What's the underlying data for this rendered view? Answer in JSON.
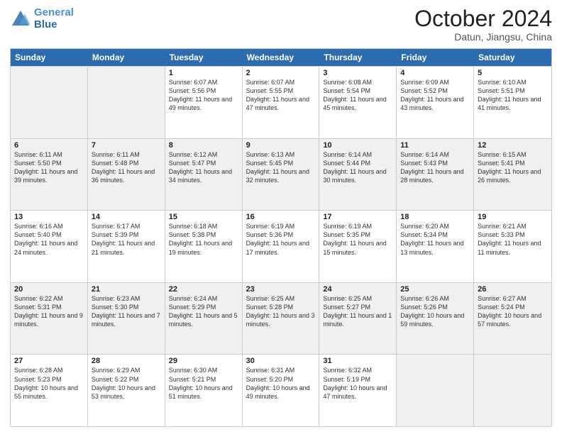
{
  "header": {
    "logo_line1": "General",
    "logo_line2": "Blue",
    "month": "October 2024",
    "location": "Datun, Jiangsu, China"
  },
  "days": [
    "Sunday",
    "Monday",
    "Tuesday",
    "Wednesday",
    "Thursday",
    "Friday",
    "Saturday"
  ],
  "weeks": [
    [
      {
        "day": "",
        "info": ""
      },
      {
        "day": "",
        "info": ""
      },
      {
        "day": "1",
        "info": "Sunrise: 6:07 AM\nSunset: 5:56 PM\nDaylight: 11 hours and 49 minutes."
      },
      {
        "day": "2",
        "info": "Sunrise: 6:07 AM\nSunset: 5:55 PM\nDaylight: 11 hours and 47 minutes."
      },
      {
        "day": "3",
        "info": "Sunrise: 6:08 AM\nSunset: 5:54 PM\nDaylight: 11 hours and 45 minutes."
      },
      {
        "day": "4",
        "info": "Sunrise: 6:09 AM\nSunset: 5:52 PM\nDaylight: 11 hours and 43 minutes."
      },
      {
        "day": "5",
        "info": "Sunrise: 6:10 AM\nSunset: 5:51 PM\nDaylight: 11 hours and 41 minutes."
      }
    ],
    [
      {
        "day": "6",
        "info": "Sunrise: 6:11 AM\nSunset: 5:50 PM\nDaylight: 11 hours and 39 minutes."
      },
      {
        "day": "7",
        "info": "Sunrise: 6:11 AM\nSunset: 5:48 PM\nDaylight: 11 hours and 36 minutes."
      },
      {
        "day": "8",
        "info": "Sunrise: 6:12 AM\nSunset: 5:47 PM\nDaylight: 11 hours and 34 minutes."
      },
      {
        "day": "9",
        "info": "Sunrise: 6:13 AM\nSunset: 5:45 PM\nDaylight: 11 hours and 32 minutes."
      },
      {
        "day": "10",
        "info": "Sunrise: 6:14 AM\nSunset: 5:44 PM\nDaylight: 11 hours and 30 minutes."
      },
      {
        "day": "11",
        "info": "Sunrise: 6:14 AM\nSunset: 5:43 PM\nDaylight: 11 hours and 28 minutes."
      },
      {
        "day": "12",
        "info": "Sunrise: 6:15 AM\nSunset: 5:41 PM\nDaylight: 11 hours and 26 minutes."
      }
    ],
    [
      {
        "day": "13",
        "info": "Sunrise: 6:16 AM\nSunset: 5:40 PM\nDaylight: 11 hours and 24 minutes."
      },
      {
        "day": "14",
        "info": "Sunrise: 6:17 AM\nSunset: 5:39 PM\nDaylight: 11 hours and 21 minutes."
      },
      {
        "day": "15",
        "info": "Sunrise: 6:18 AM\nSunset: 5:38 PM\nDaylight: 11 hours and 19 minutes."
      },
      {
        "day": "16",
        "info": "Sunrise: 6:19 AM\nSunset: 5:36 PM\nDaylight: 11 hours and 17 minutes."
      },
      {
        "day": "17",
        "info": "Sunrise: 6:19 AM\nSunset: 5:35 PM\nDaylight: 11 hours and 15 minutes."
      },
      {
        "day": "18",
        "info": "Sunrise: 6:20 AM\nSunset: 5:34 PM\nDaylight: 11 hours and 13 minutes."
      },
      {
        "day": "19",
        "info": "Sunrise: 6:21 AM\nSunset: 5:33 PM\nDaylight: 11 hours and 11 minutes."
      }
    ],
    [
      {
        "day": "20",
        "info": "Sunrise: 6:22 AM\nSunset: 5:31 PM\nDaylight: 11 hours and 9 minutes."
      },
      {
        "day": "21",
        "info": "Sunrise: 6:23 AM\nSunset: 5:30 PM\nDaylight: 11 hours and 7 minutes."
      },
      {
        "day": "22",
        "info": "Sunrise: 6:24 AM\nSunset: 5:29 PM\nDaylight: 11 hours and 5 minutes."
      },
      {
        "day": "23",
        "info": "Sunrise: 6:25 AM\nSunset: 5:28 PM\nDaylight: 11 hours and 3 minutes."
      },
      {
        "day": "24",
        "info": "Sunrise: 6:25 AM\nSunset: 5:27 PM\nDaylight: 11 hours and 1 minute."
      },
      {
        "day": "25",
        "info": "Sunrise: 6:26 AM\nSunset: 5:26 PM\nDaylight: 10 hours and 59 minutes."
      },
      {
        "day": "26",
        "info": "Sunrise: 6:27 AM\nSunset: 5:24 PM\nDaylight: 10 hours and 57 minutes."
      }
    ],
    [
      {
        "day": "27",
        "info": "Sunrise: 6:28 AM\nSunset: 5:23 PM\nDaylight: 10 hours and 55 minutes."
      },
      {
        "day": "28",
        "info": "Sunrise: 6:29 AM\nSunset: 5:22 PM\nDaylight: 10 hours and 53 minutes."
      },
      {
        "day": "29",
        "info": "Sunrise: 6:30 AM\nSunset: 5:21 PM\nDaylight: 10 hours and 51 minutes."
      },
      {
        "day": "30",
        "info": "Sunrise: 6:31 AM\nSunset: 5:20 PM\nDaylight: 10 hours and 49 minutes."
      },
      {
        "day": "31",
        "info": "Sunrise: 6:32 AM\nSunset: 5:19 PM\nDaylight: 10 hours and 47 minutes."
      },
      {
        "day": "",
        "info": ""
      },
      {
        "day": "",
        "info": ""
      }
    ]
  ]
}
